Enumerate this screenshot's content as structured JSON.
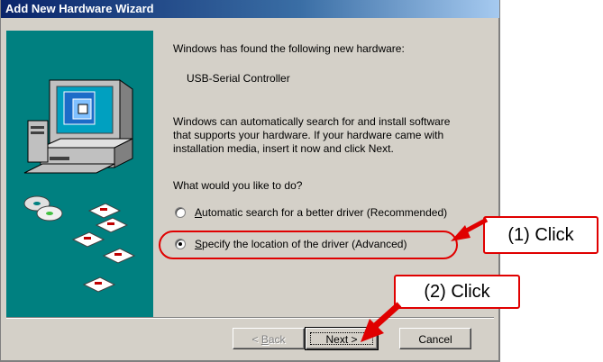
{
  "window": {
    "title": "Add New Hardware Wizard"
  },
  "body": {
    "found_text": "Windows has found the following new hardware:",
    "device_name": "USB-Serial Controller",
    "description_line1": "Windows can automatically search for and install software",
    "description_line2": "that supports your hardware. If your hardware came with",
    "description_line3": "installation media, insert it now and click Next.",
    "question": "What would you like to do?"
  },
  "options": [
    {
      "label_first": "A",
      "label_rest": "utomatic search for a better driver (Recommended)",
      "selected": false
    },
    {
      "label_first": "S",
      "label_rest": "pecify the location of the driver (Advanced)",
      "selected": true
    }
  ],
  "buttons": {
    "back_prefix": "< ",
    "back_underline": "B",
    "back_rest": "ack",
    "next": "Next >",
    "cancel": "Cancel"
  },
  "annotations": {
    "click1": "(1) Click",
    "click2": "(2) Click",
    "color": "#e00000"
  }
}
